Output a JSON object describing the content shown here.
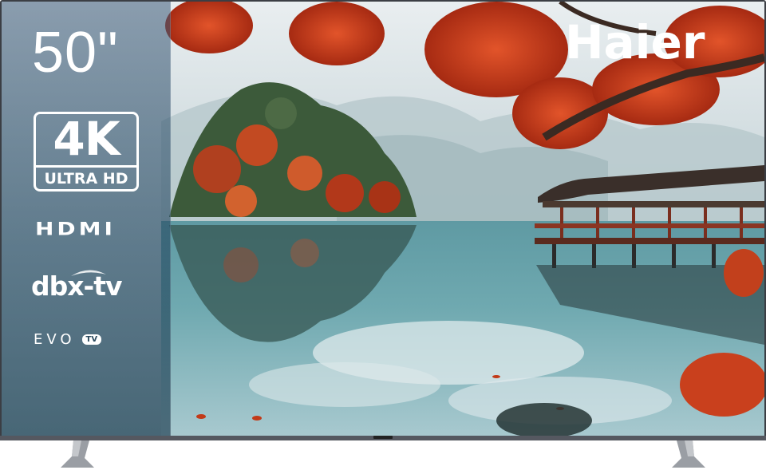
{
  "product": {
    "screen_size": "50\"",
    "brand": "Haier"
  },
  "spec_badges": {
    "resolution_big": "4K",
    "resolution_small": "ULTRA HD",
    "hdmi": "HDMI",
    "audio": "dbx-tv",
    "platform": "EVO",
    "platform_badge": "TV"
  },
  "colors": {
    "frame": "#3b3e44",
    "foliage_red": "#d2421c",
    "water_teal": "#6fa9b0",
    "panel_overlay": "#2e5670"
  }
}
